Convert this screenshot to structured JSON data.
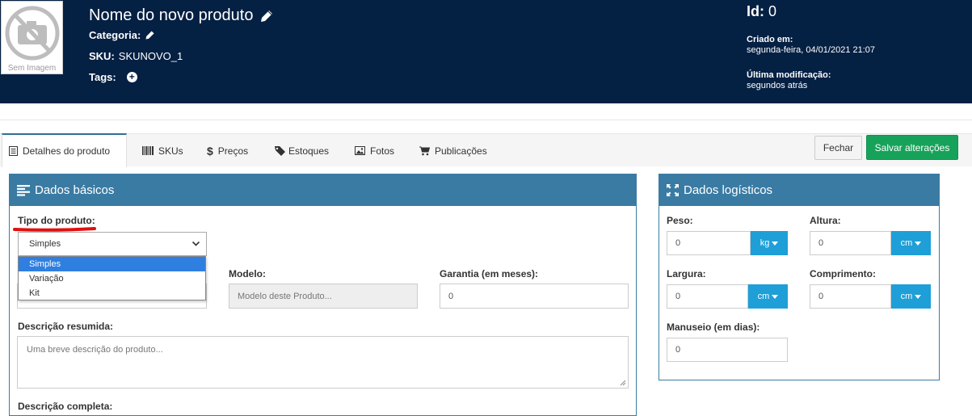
{
  "header": {
    "thumb_caption": "Sem Imagem",
    "product_name": "Nome do novo produto",
    "category_label": "Categoria:",
    "sku_label": "SKU:",
    "sku_value": "SKUNOVO_1",
    "tags_label": "Tags:",
    "id_label": "Id:",
    "id_value": "0",
    "created_label": "Criado em:",
    "created_value": "segunda-feira, 04/01/2021 21:07",
    "modified_label": "Última modificação:",
    "modified_value": "segundos atrás"
  },
  "tabs": [
    {
      "label": "Detalhes do produto",
      "icon": "list-icon"
    },
    {
      "label": "SKUs",
      "icon": "barcode-icon"
    },
    {
      "label": "Preços",
      "icon": "dollar-icon"
    },
    {
      "label": "Estoques",
      "icon": "tag-icon"
    },
    {
      "label": "Fotos",
      "icon": "image-icon"
    },
    {
      "label": "Publicações",
      "icon": "cart-icon"
    }
  ],
  "actions": {
    "close_label": "Fechar",
    "save_label": "Salvar alterações"
  },
  "basic": {
    "title": "Dados básicos",
    "type_label": "Tipo do produto:",
    "type_value": "Simples",
    "type_options": [
      "Simples",
      "Variação",
      "Kit"
    ],
    "model_label": "Modelo:",
    "model_placeholder": "Modelo deste Produto...",
    "warranty_label": "Garantia (em meses):",
    "warranty_value": "0",
    "short_desc_label": "Descrição resumida:",
    "short_desc_placeholder": "Uma breve descrição do produto...",
    "full_desc_label": "Descrição completa:"
  },
  "logistics": {
    "title": "Dados logísticos",
    "weight_label": "Peso:",
    "weight_value": "0",
    "weight_unit": "kg",
    "height_label": "Altura:",
    "height_value": "0",
    "height_unit": "cm",
    "width_label": "Largura:",
    "width_value": "0",
    "width_unit": "cm",
    "length_label": "Comprimento:",
    "length_value": "0",
    "length_unit": "cm",
    "handling_label": "Manuseio (em dias):",
    "handling_value": "0"
  },
  "colors": {
    "header_bg": "#042043",
    "panel_accent": "#3a7ba3",
    "save_green": "#17a25a",
    "unit_blue": "#1e9fd8",
    "annotation_red": "#e01010"
  }
}
